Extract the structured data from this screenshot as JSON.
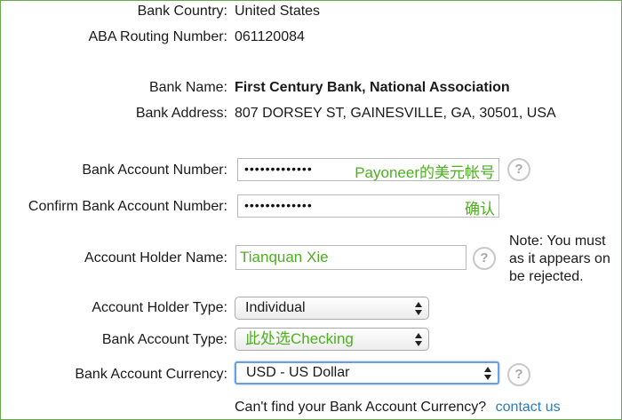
{
  "bank_info": {
    "country_label": "Bank Country:",
    "country_value": "United States",
    "routing_label": "ABA Routing Number:",
    "routing_value": "061120084",
    "name_label": "Bank Name:",
    "name_value": "First Century Bank, National Association",
    "address_label": "Bank Address:",
    "address_value": "807 DORSEY ST, GAINESVILLE, GA, 30501, USA"
  },
  "form": {
    "account_number_label": "Bank Account Number:",
    "account_number_masked": "•••••••••••••",
    "account_number_annotation": "Payoneer的美元帐号",
    "confirm_label": "Confirm Bank Account Number:",
    "confirm_masked": "•••••••••••••",
    "confirm_annotation": "确认",
    "holder_name_label": "Account Holder Name:",
    "holder_name_value": "Tianquan Xie",
    "holder_type_label": "Account Holder Type:",
    "holder_type_value": "Individual",
    "account_type_label": "Bank Account Type:",
    "account_type_value": "此处选Checking",
    "currency_label": "Bank Account Currency:",
    "currency_value": "USD - US Dollar",
    "help_glyph": "?",
    "cant_find_text": "Can't find your Bank Account Currency?",
    "contact_link": "contact us"
  },
  "note": {
    "line1": "Note: You must",
    "line2": "as it appears on",
    "line3": "be rejected."
  },
  "colors": {
    "annotation_green": "#4caf1f",
    "link_blue": "#2b7bb9",
    "focus_blue": "#6b9fe3"
  }
}
